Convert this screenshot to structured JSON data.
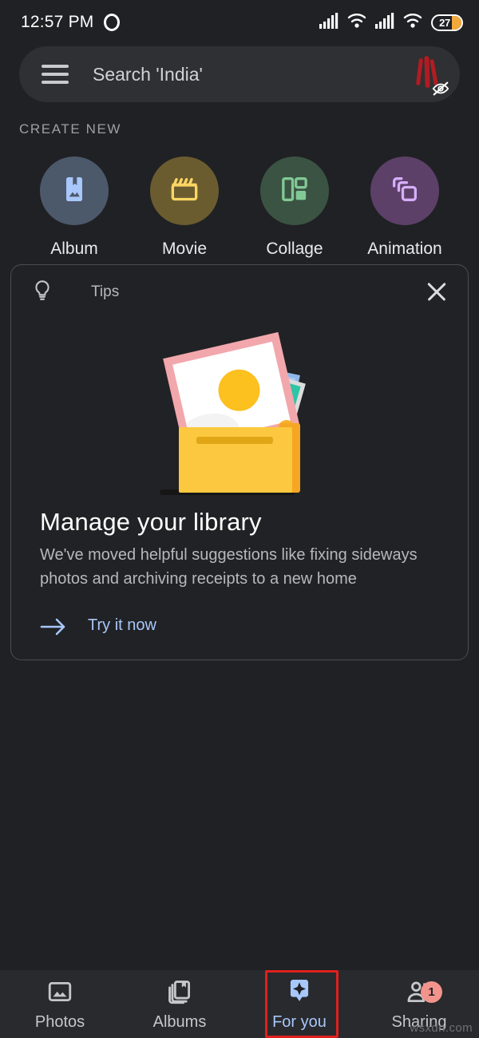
{
  "status_bar": {
    "time": "12:57 PM",
    "recording_icon": "circle-outline-icon",
    "signal_icon_1": "signal-bars-icon",
    "wifi_icon_1": "wifi-icon",
    "signal_icon_2": "signal-bars-icon",
    "wifi_icon_2": "wifi-icon",
    "battery_percent": "27"
  },
  "search": {
    "menu_icon": "hamburger-menu-icon",
    "placeholder": "Search 'India'",
    "avatar_icon": "account-avatar",
    "avatar_badge_icon": "eye-off-icon"
  },
  "create_new": {
    "section_label": "CREATE NEW",
    "items": [
      {
        "label": "Album",
        "icon": "photo-book-icon",
        "circle_color": "#4c596b",
        "icon_color": "#a8c7fa"
      },
      {
        "label": "Movie",
        "icon": "clapperboard-icon",
        "circle_color": "#6b5c30",
        "icon_color": "#fcd663"
      },
      {
        "label": "Collage",
        "icon": "collage-grid-icon",
        "circle_color": "#3b5343",
        "icon_color": "#81c995"
      },
      {
        "label": "Animation",
        "icon": "stacked-frames-icon",
        "circle_color": "#5c4068",
        "icon_color": "#d7aefb"
      }
    ]
  },
  "tips_card": {
    "header_icon": "lightbulb-icon",
    "header_label": "Tips",
    "close_icon": "close-icon",
    "illustration": "photo-box-illustration",
    "title": "Manage your library",
    "body": "We've moved helpful suggestions like fixing sideways photos and archiving receipts to a new home",
    "cta_icon": "arrow-right-icon",
    "cta_label": "Try it now"
  },
  "bottom_nav": {
    "items": [
      {
        "label": "Photos",
        "icon": "photo-image-icon",
        "active": false,
        "badge": ""
      },
      {
        "label": "Albums",
        "icon": "albums-books-icon",
        "active": false,
        "badge": ""
      },
      {
        "label": "For you",
        "icon": "for-you-star-pin-icon",
        "active": true,
        "badge": ""
      },
      {
        "label": "Sharing",
        "icon": "person-share-icon",
        "active": false,
        "badge": "1"
      }
    ],
    "highlight_color": "#e02020",
    "active_color": "#a8c7fa"
  },
  "watermark": "wsxdn.com"
}
